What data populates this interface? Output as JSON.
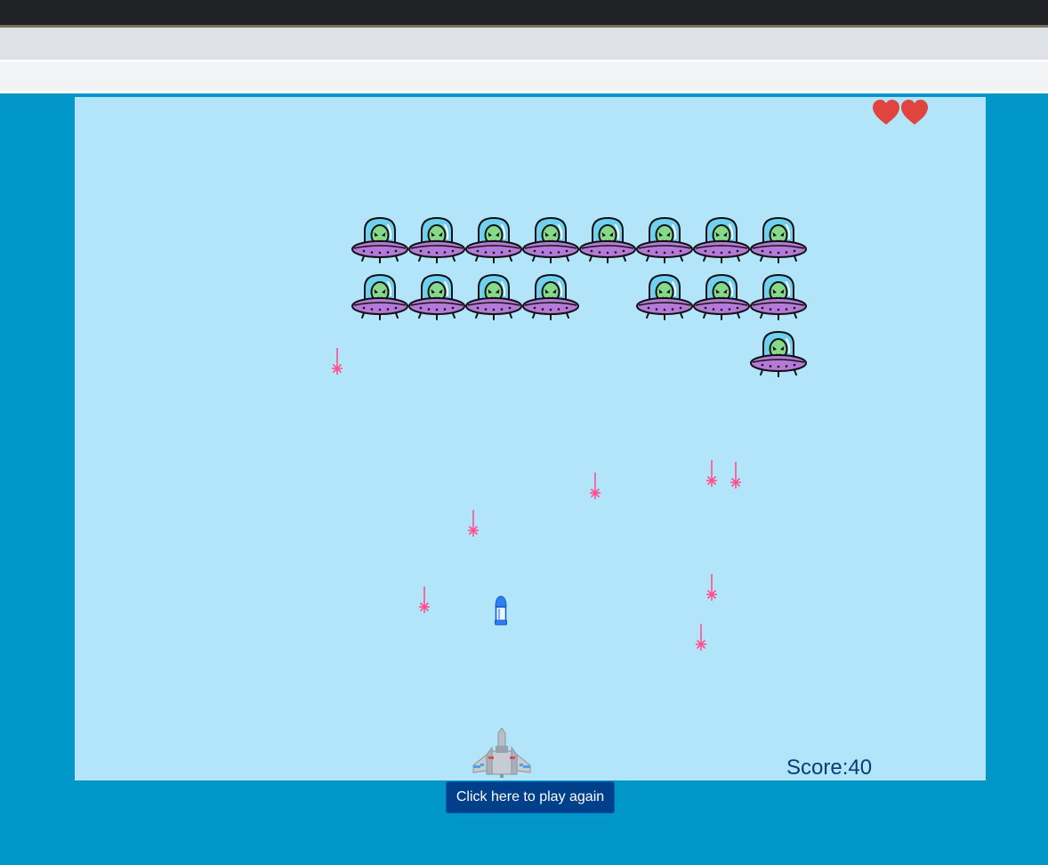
{
  "game": {
    "score_label": "Score:",
    "score_value": "40",
    "lives": 2,
    "play_again_label": "Click here to play again"
  },
  "icons": {
    "life": "heart-icon",
    "enemy": "alien-ufo-icon",
    "enemy_shot": "laser-icon",
    "player_shot": "bullet-icon",
    "player": "spaceship-icon"
  },
  "colors": {
    "page_background": "#0096c8",
    "game_background": "#b3e5fa",
    "heart": "#e0443e",
    "laser": "#ff4f8b",
    "button": "#003f8a",
    "score_text": "#0b3c78"
  }
}
